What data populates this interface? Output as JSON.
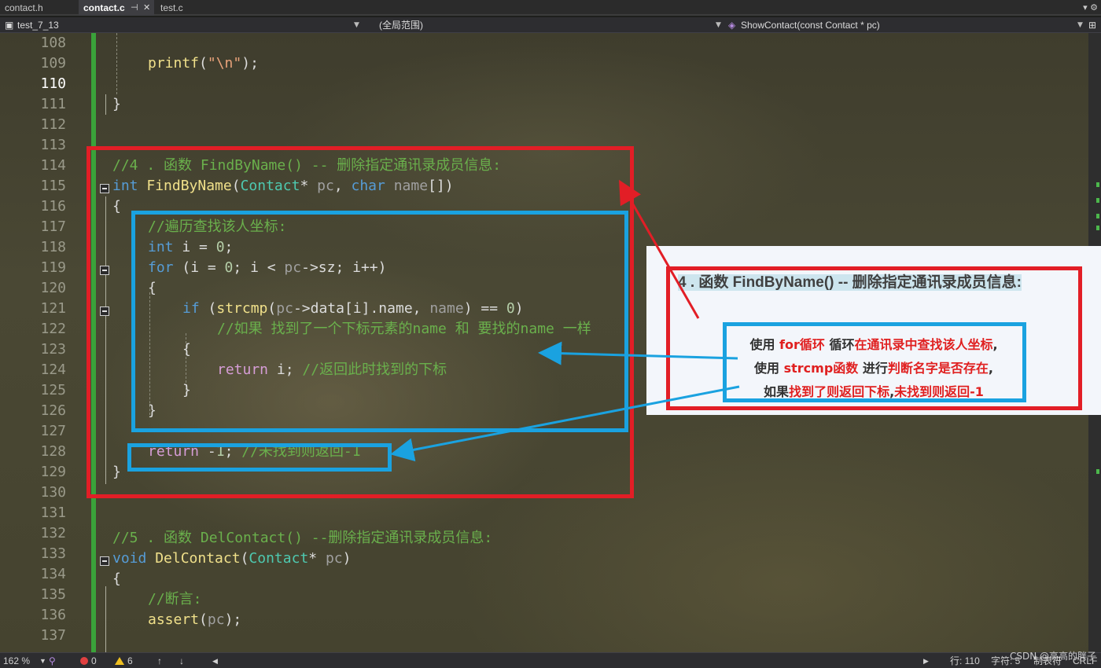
{
  "tabs": [
    {
      "label": "contact.h"
    },
    {
      "label": "contact.c",
      "active": true
    },
    {
      "label": "test.c"
    }
  ],
  "tab_controls": {
    "pin": "⊣",
    "close": "✕"
  },
  "tabbar_right": "▾ ⚙",
  "navbar": {
    "project": "test_7_13",
    "scope": "(全局范围)",
    "member": "ShowContact(const Contact * pc)"
  },
  "line_numbers": [
    "108",
    "109",
    "110",
    "111",
    "112",
    "113",
    "114",
    "115",
    "116",
    "117",
    "118",
    "119",
    "120",
    "121",
    "122",
    "123",
    "124",
    "125",
    "126",
    "127",
    "128",
    "129",
    "130",
    "131",
    "132",
    "133",
    "134",
    "135",
    "136",
    "137"
  ],
  "current_line": "110",
  "code": {
    "l109": {
      "fn": "printf",
      "open": "(",
      "str": "\"\\n\"",
      "close": ");"
    },
    "l111": "}",
    "l114": "//4 . 函数 FindByName() -- 删除指定通讯录成员信息:",
    "l115": {
      "kw": "int",
      "fn": "FindByName",
      "type": "Contact",
      "rest1": "* ",
      "param1": "pc",
      "comma": ", ",
      "kw2": "char",
      "sp": " ",
      "param2": "name",
      "end": "[])"
    },
    "l116": "{",
    "l117": "//遍历查找该人坐标:",
    "l118": {
      "kw": "int",
      "rest": " i = ",
      "num": "0",
      "end": ";"
    },
    "l119": {
      "kw": "for",
      "a": " (i = ",
      "num": "0",
      "b": "; i < ",
      "p": "pc",
      "c": "->sz; i++)"
    },
    "l120": "{",
    "l121": {
      "kw": "if",
      "a": " (",
      "fn": "strcmp",
      "b": "(",
      "p": "pc",
      "c": "->data[i].name, ",
      "p2": "name",
      "d": ") == ",
      "num": "0",
      "e": ")"
    },
    "l122": "//如果 找到了一个下标元素的name 和 要找的name 一样",
    "l123": "{",
    "l124": {
      "kw": "return",
      "a": " i; ",
      "cm": "//返回此时找到的下标"
    },
    "l125": "}",
    "l126": "}",
    "l128": {
      "kw": "return",
      "a": " -",
      "num": "1",
      "b": "; ",
      "cm": "//未找到则返回-1"
    },
    "l129": "}",
    "l132": "//5 . 函数 DelContact() --删除指定通讯录成员信息:",
    "l133": {
      "kw": "void",
      "fn": "DelContact",
      "b": "(",
      "type": "Contact",
      "c": "* ",
      "p": "pc",
      "d": ")"
    },
    "l134": "{",
    "l135": "//断言:",
    "l136": {
      "fn": "assert",
      "a": "(",
      "p": "pc",
      "b": ");"
    }
  },
  "callout": {
    "title": "4 . 函数 FindByName() -- 删除指定通讯录成员信息:",
    "line1": {
      "a": "使用 ",
      "b": "for循环",
      "c": " 循环",
      "d": "在通讯录中查找该人坐标",
      "e": ","
    },
    "line2": {
      "a": "使用 ",
      "b": "strcmp函数",
      "c": " 进行",
      "d": "判断名字是否存在",
      "e": ","
    },
    "line3": {
      "a": "如果",
      "b": "找到了则返回下标",
      "c": ",",
      "d": "未找到则返回-1"
    }
  },
  "colors": {
    "red_box": "#e21e26",
    "blue_box": "#1aa2e0"
  },
  "status": {
    "zoom": "162 %",
    "errors": "0",
    "warnings": "6",
    "up_arrow": "↑",
    "down_arrow": "↓",
    "line": "行: 110",
    "char": "字符: 5",
    "tab": "制表符",
    "eol": "CRLF"
  },
  "watermark": "CSDN @高高的胖子"
}
